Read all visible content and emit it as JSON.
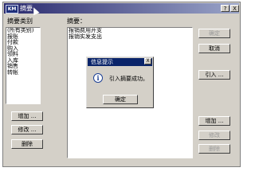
{
  "window": {
    "title": "摘要",
    "app_icon_text": "KM",
    "help_label": "?",
    "close_label": "X"
  },
  "left_panel": {
    "category_label": "摘要类别",
    "categories": [
      "(所有类别)",
      "报账",
      "付款",
      "购入",
      "领料",
      "入库",
      "销售",
      "转帐"
    ],
    "selected_index": 1,
    "add_label": "增加 ...",
    "edit_label": "修改 ...",
    "delete_label": "删除"
  },
  "right_panel": {
    "summary_label": "摘要：",
    "summaries": [
      "报销费用开支",
      "报销实发支出"
    ],
    "ok_label": "确定",
    "cancel_label": "取消",
    "import_label": "引入 ...",
    "add_label": "增加 ...",
    "edit_label": "修改",
    "delete_label": "删除"
  },
  "dialog": {
    "title": "信息提示",
    "close_label": "X",
    "message": "引入摘要成功。",
    "ok_label": "确定"
  }
}
